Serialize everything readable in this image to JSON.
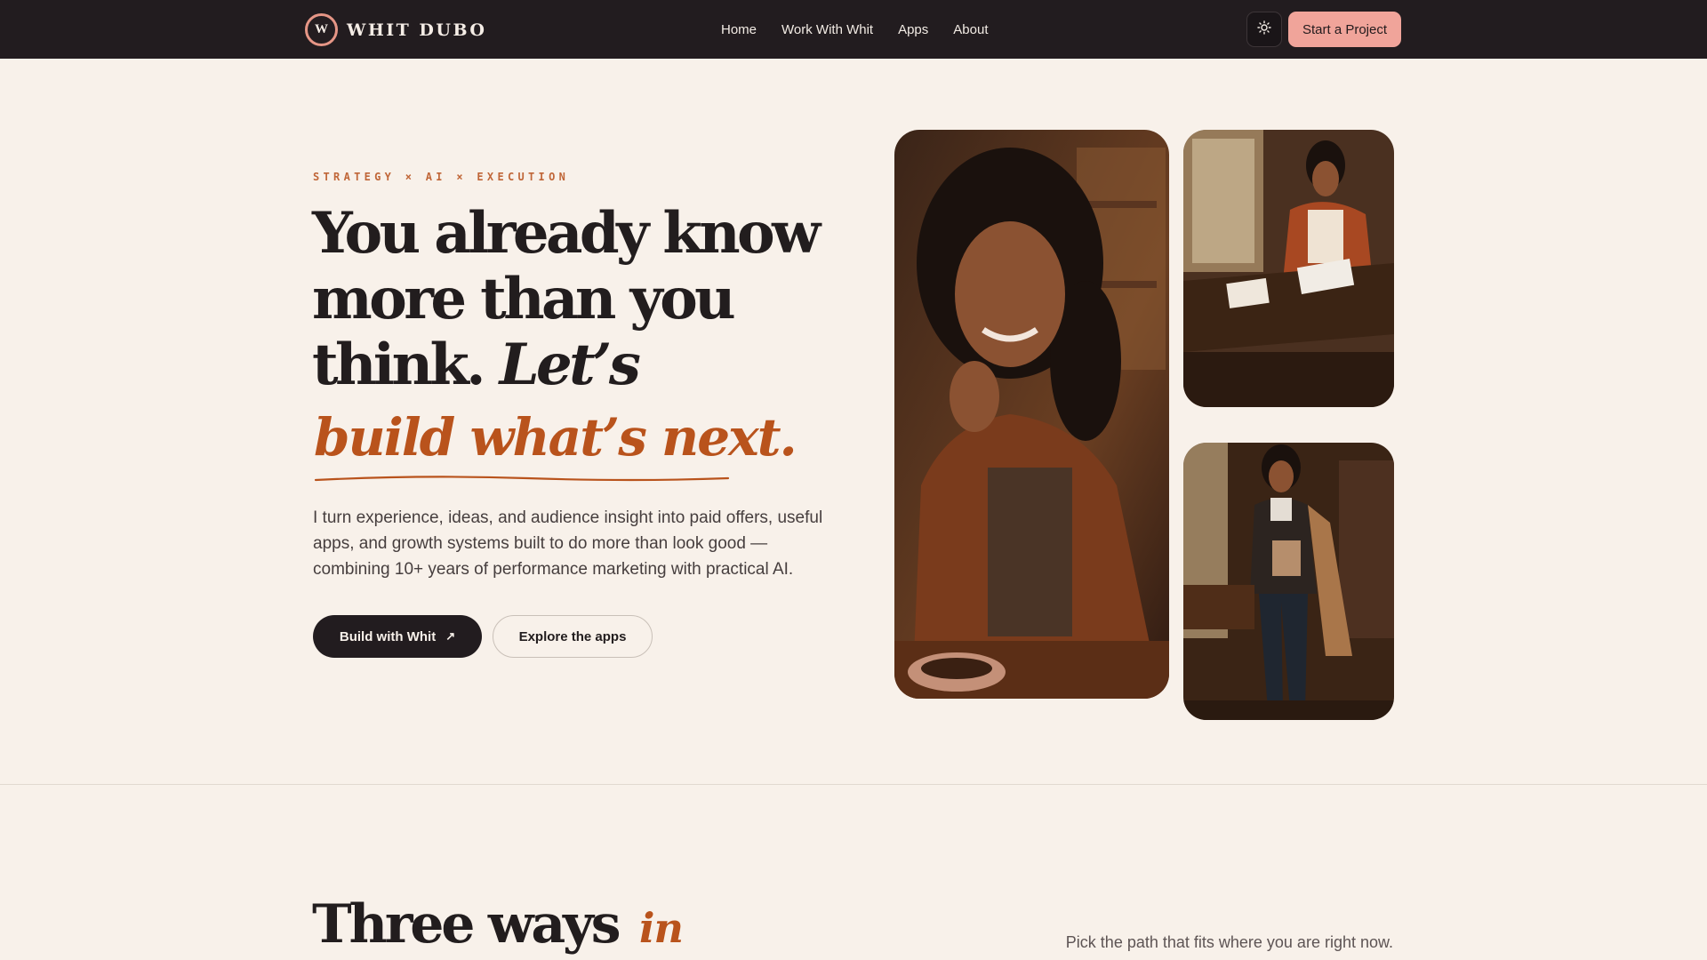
{
  "nav": {
    "logo_mark": "W",
    "brand": "WHIT DUBO",
    "links": [
      "Home",
      "Work With Whit",
      "Apps",
      "About"
    ],
    "theme_icon": "sun-icon",
    "cta_label": "Start a Project"
  },
  "hero": {
    "eyebrow": "STRATEGY × AI × EXECUTION",
    "headline_lines": [
      "You already know",
      "more than you",
      "think."
    ],
    "headline_italic": "Let’s",
    "script": "build what’s next.",
    "body": "I turn experience, ideas, and audience insight into paid offers, useful apps, and growth systems built to do more than look good — combining 10+ years of performance marketing with practical AI.",
    "primary_button": "Build with Whit",
    "primary_button_icon": "arrow-up-right-icon",
    "secondary_button": "Explore the apps"
  },
  "section2": {
    "title": "Three ways",
    "title_accent": "in",
    "subtitle": "Pick the path that fits where you are right now."
  },
  "colors": {
    "background": "#f8f1ea",
    "nav_bg": "#221c1f",
    "accent": "#b9531c",
    "cta": "#f0a49a",
    "text": "#221d1e"
  }
}
